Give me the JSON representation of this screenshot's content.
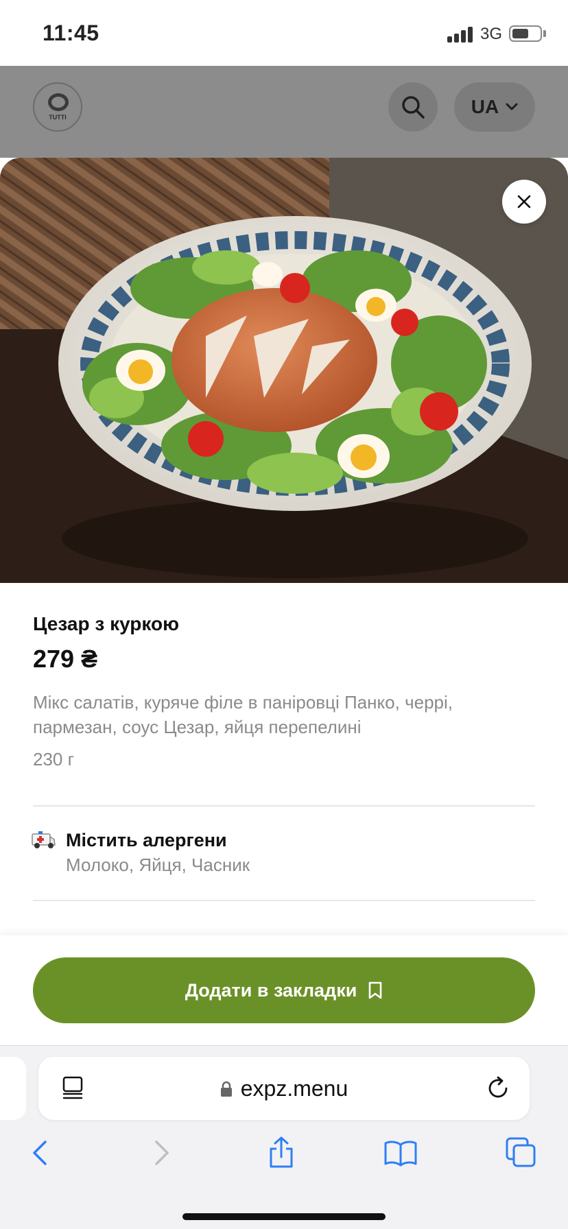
{
  "status_bar": {
    "time": "11:45",
    "network": "3G",
    "battery_level": 0.6
  },
  "header": {
    "logo_text": "TUTTI",
    "language": "UA",
    "icons": {
      "search": "search-icon",
      "language_chevron": "chevron-down-icon"
    }
  },
  "dish": {
    "title": "Цезар з куркою",
    "price": "279 ₴",
    "description": "Мікс салатів, куряче філе в паніровці Панко, черрі, пармезан, соус Цезар, яйця перепелині",
    "weight": "230 г",
    "allergens_title": "Містить алергени",
    "allergens": "Молоко, Яйця, Часник",
    "icons": {
      "close": "close-icon",
      "allergen": "ambulance-icon"
    }
  },
  "actions": {
    "bookmark_label": "Додати в закладки",
    "bookmark_icon": "bookmark-icon",
    "button_color": "#6a9127"
  },
  "browser": {
    "url": "expz.menu",
    "icons": [
      "reader-icon",
      "lock-icon",
      "reload-icon",
      "back-icon",
      "forward-icon",
      "share-icon",
      "bookmarks-icon",
      "tabs-icon"
    ]
  }
}
